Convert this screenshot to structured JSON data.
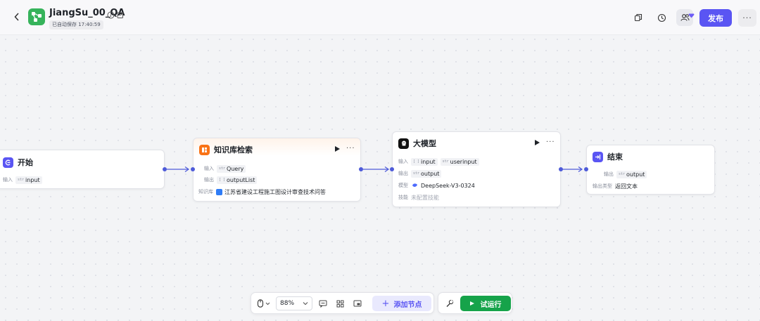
{
  "header": {
    "title": "JiangSu_00_QA",
    "autosave": "已自动保存 17:40:59",
    "publish_label": "发布",
    "more_label": "···"
  },
  "nodes": {
    "start": {
      "title": "开始",
      "input_label": "输入",
      "input_type": "str",
      "input_name": "input"
    },
    "knowledge": {
      "title": "知识库检索",
      "input_label": "输入",
      "input_type": "str",
      "input_name": "Query",
      "output_label": "输出",
      "output_type": "[ ]",
      "output_name": "outputList",
      "kb_label": "知识库",
      "kb_name": "江苏省建设工程施工图设计审查技术问答"
    },
    "llm": {
      "title": "大模型",
      "input_label": "输入",
      "input1_type": "[ ]",
      "input1_name": "input",
      "input2_type": "str",
      "input2_name": "userinput",
      "output_label": "输出",
      "output_type": "str",
      "output_name": "output",
      "model_label": "模型",
      "model_name": "DeepSeek-V3-0324",
      "skill_label": "技能",
      "skill_value": "未配置技能"
    },
    "end": {
      "title": "结束",
      "output_label": "输出",
      "output_type": "str",
      "output_name": "output",
      "output_kind_label": "输出类型",
      "output_kind_value": "返回文本"
    }
  },
  "toolbar": {
    "zoom": "88%",
    "add_node_label": "添加节点",
    "test_run_label": "试运行"
  },
  "colors": {
    "brand": "#5a55f3",
    "run_green": "#16a34a",
    "app_logo": "#36b35b",
    "knowledge_icon": "#f97316",
    "start_icon": "#5a55f3",
    "edge": "#4e5bd9"
  },
  "icons": [
    "back-icon",
    "app-logo-icon",
    "info-icon",
    "edit-icon",
    "copy-icon",
    "history-icon",
    "collab-icon",
    "mouse-icon",
    "chevron-down-icon",
    "comment-icon",
    "grid-icon",
    "minimap-icon",
    "plus-icon",
    "wrench-icon",
    "play-icon"
  ]
}
